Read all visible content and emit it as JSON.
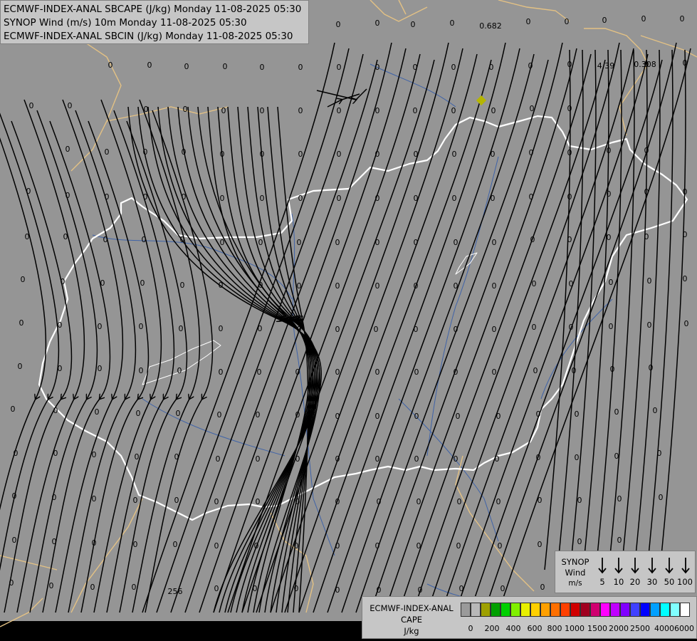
{
  "header": {
    "line1": "ECMWF-INDEX-ANAL SBCAPE (J/kg) Monday 11-08-2025 05:30",
    "line2": "SYNOP Wind (m/s) 10m Monday 11-08-2025 05:30",
    "line3": "ECMWF-INDEX-ANAL SBCIN (J/kg) Monday 11-08-2025 05:30"
  },
  "map": {
    "background_color": "#959595",
    "border_color": "#ffffff",
    "neighbor_border_color": "#e3c184",
    "river_color": "#3f63a8",
    "streamline_color": "#000000",
    "special_values": [
      "0.682",
      "4.39",
      "0.308",
      "256"
    ],
    "marker_color": "#b5b500",
    "grid_value": "0"
  },
  "synop_legend": {
    "title": "SYNOP",
    "subtitle": "Wind",
    "unit": "m/s",
    "speeds": [
      "5",
      "10",
      "20",
      "30",
      "50",
      "100"
    ]
  },
  "cape_legend": {
    "line1": "ECMWF-INDEX-ANAL",
    "line2": "CAPE",
    "unit": "J/kg",
    "colors": [
      "#9a9a9a",
      "#b8b8b8",
      "#9ea000",
      "#00a000",
      "#00d000",
      "#80f000",
      "#e8f000",
      "#ffd000",
      "#ffa000",
      "#ff7000",
      "#ff4000",
      "#d00000",
      "#a00020",
      "#d00070",
      "#ff00ff",
      "#c000ff",
      "#8000ff",
      "#4040ff",
      "#0000ff",
      "#00a0ff",
      "#00ffff",
      "#80ffff",
      "#ffffff"
    ],
    "ticks": [
      "0",
      "200",
      "400",
      "600",
      "800",
      "1000",
      "1500",
      "2000",
      "2500",
      "4000",
      "6000"
    ]
  }
}
